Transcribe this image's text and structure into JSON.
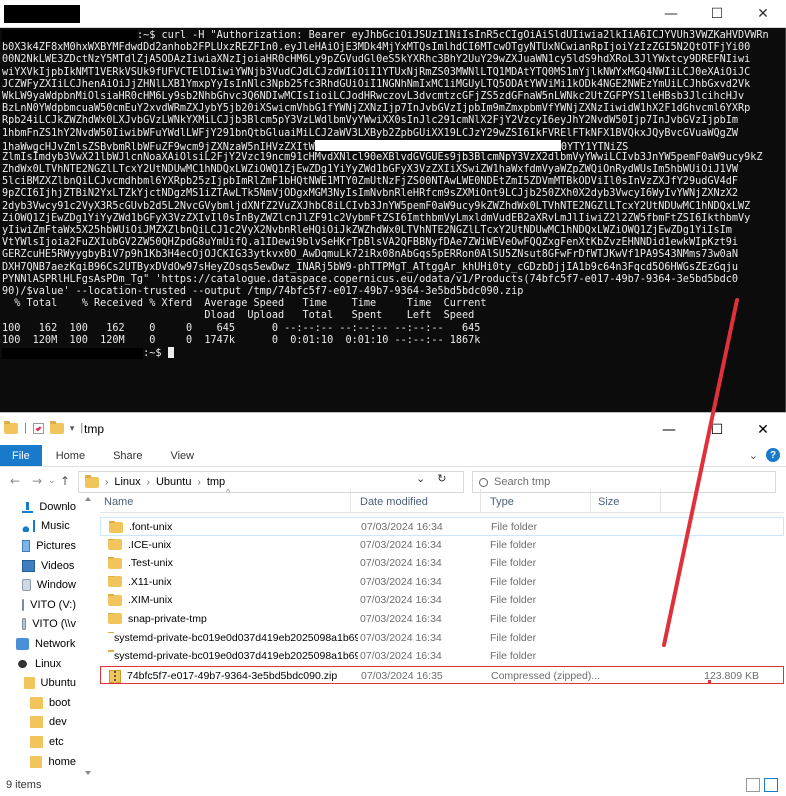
{
  "terminal": {
    "window_controls": [
      "—",
      "☐",
      "✕"
    ],
    "lines": [
      {
        "redact": "                      ",
        "text": ":~$ curl -H \"Authorization: Bearer eyJhbGciOiJSUzI1NiIsInR5cCIgOiAiSldUIiwia2lkIiA6ICJYVUh3VWZKaHVDVWRn"
      },
      {
        "text": "b0X3k4ZF8xM0hxWXBYMFdwdDd2anhob2FPLUxzREZFIn0.eyJleHAiOjE3MDk4MjYxMTQsImlhdCI6MTcwOTgyNTUxNCwianRpIjoiYzIzZGI5N2QtOTFjYi00"
      },
      {
        "text": "00N2NkLWE3ZDctNzY5MTdlZjA5ODAzIiwiaXNzIjoiaHR0cHM6Ly9pZGVudGl0eS5kYXRhc3BhY2UuY29wZXJuaWN1cy5ldS9hdXRoL3JlYWxtcy9DREFNIiwi"
      },
      {
        "text": "wiYXVkIjpbIkNMT1VERkVSUk9fUFVCTElDIiwiYWNjb3VudCJdLCJzdWIiOiI1YTUxNjRmZS03MWNlLTQ1MDAtYTQ0MS1mYjlkNWYxMGQ4NWIiLCJ0eXAiOiJC"
      },
      {
        "text": "JCZWFyZXIiLCJhenAiOiJjZHNlLXB1YmxpYyIsInNlc3Npb25fc3RhdGUiOiI1NGNhNmIxMC1iMGUyLTQ5ODAtYWViMi1kODk4NGE2NWEzYmUiLCJhbGxvd2Vk"
      },
      {
        "text": "WkLW9yaWdpbnMiOlsiaHR0cHM6Ly9sb2NhbGhvc3Q6NDIwMCIsIioiLCJodHRwczovL3dvcmtzcGFjZS5zdGFnaW5nLWNkc2UtZGFPYS1leHBsb3JlcihcHJv"
      },
      {
        "text": "BzLnN0YWdpbmcuaW50cmEuY2xvdWRmZXJybY5jb20iXSwicmVhbG1fYWNjZXNzIjp7InJvbGVzIjpbIm9mZmxpbmVfYWNjZXNzIiwidW1hX2F1dGhvcml6YXRp"
      },
      {
        "text": "Rpb24iLCJkZWZhdWx0LXJvbGVzLWNkYXMiLCJjb3Blcm5pY3VzLWdlbmVyYWwiXX0sInJlc291cmNlX2FjY2VzcyI6eyJhY2NvdW50Ijp7InJvbGVzIjpbIm"
      },
      {
        "text": "1hbmFnZS1hY2NvdW50IiwibWFuYWdlLWFjY291bnQtbGluaiMiLCJ2aWV3LXByb2ZpbGUiXX19LCJzY29wZSI6IkFVRElFTkNFX1BVQkxJQyBvcGVuaWQgZW"
      },
      {
        "text": "1haWwgcHJvZmlsZSBvbmRlbWFuZF9wcm9jZXNzaW5nIHVzZXItW",
        "whitebar": 40,
        "tail": "0YTY1YTNiZS"
      },
      {
        "text": "ZlmIsImdyb3VwX21lbWJlcnNoaXAiOlsiL2FjY2Vzc19ncm91cHMvdXNlcl90eXBlvdGVGUEs9jb3BlcmNpY3VzX2dlbmVyYWwiLCIvb3JnYW5pemF0aW9ucy9kZ"
      },
      {
        "text": "ZhdWx0LTVhNTE2NGZlLTcxY2UtNDUwMC1hNDQxLWZiOWQ1ZjEwZDg1YiYyZWd1bGFyX3VzZXIiXSwiZW1haWxfdmVyaWZpZWQiOnRydWUsIm5hbWUiOiJ1VW"
      },
      {
        "text": "5lciBMZXZlbnQiLCJvcmdhbml6YXRpb25zIjpbImRlZmF1bHQtNWE1MTY0ZmUtNzFjZS00NTAwLWE0NDEtZmI5ZDVmMTBkODViIl0sInVzZXJfY29udGV4dF"
      },
      {
        "text": "9pZCI6IjhjZTBiN2YxLTZkYjctNDgzMS1iZTAwLTk5NmVjODgxMGM3NyIsImNvbnRleHRfcm9sZXMiOnt9LCJjb250ZXh0X2dyb3VwcyI6WyIvYWNjZXNzX2"
      },
      {
        "text": "2dyb3Vwcy91c2VyX3R5cGUvb2d5L2NvcGVybmljdXNfZ2VuZXJhbC8iLCIvb3JnYW5pemF0aW9ucy9kZWZhdWx0LTVhNTE2NGZlLTcxY2UtNDUwMC1hNDQxLWZ"
      },
      {
        "text": "ZiOWQ1ZjEwZDg1YiYyZWd1bGFyX3VzZXIvIl0sInByZWZlcnJlZF91c2VybmFtZSI6ImthbmVyLmxldmVudEB2aXRvLmJlIiwiZ2l2ZW5fbmFtZSI6IkthbmVy"
      },
      {
        "text": "yIiwiZmFtaWx5X25hbWUiOiJMZXZlbnQiLCJ1c2VyX2NvbnRleHQiOiJkZWZhdWx0LTVhNTE2NGZlLTcxY2UtNDUwMC1hNDQxLWZiOWQ1ZjEwZDg1YiIsIm"
      },
      {
        "text": "VtYWlsIjoia2FuZXIubGV2ZW50QHZpdG8uYmUifQ.a1IDewi9blvSeHKrTpBlsVA2QFBBNyfDAe7ZWiWEVeOwFQQZxgFenXtKbZvzEHNNDid1ewkWIpKzt9i"
      },
      {
        "text": "GERZcuHE5RWyygbyBiV7p9h1Kb3H4ecOjOJCKIG33ytkvx0O_AwDqmuLk72iRx08nAbGqs5pERRon0AlSU5ZNsut8GFwFrDfWTJKwVf1PA9S43NMms73w0aN"
      },
      {
        "text": "DXH7QNB7aezKqiB96Cs2UTByxDVdOw97sHeyZOsqs5ewDwz_INARj5bW9-phTTPMgT_ATtggAr_khUHi0ty_cGDzbDjjIA1b9c64n3Fqcd5O6HWGsZEzGqju"
      },
      {
        "text": "PYNNlASPRlHLFgsAsPDm_Tg\" 'https://catalogue.dataspace.copernicus.eu/odata/v1/Products(74bfc5f7-e017-49b7-9364-3e5bd5bdc0"
      },
      {
        "text": "90)/$value' --location-trusted --output /tmp/74bfc5f7-e017-49b7-9364-3e5bd5bdc090.zip"
      },
      {
        "text": "  % Total    % Received % Xferd  Average Speed   Time    Time     Time  Current"
      },
      {
        "text": "                                 Dload  Upload   Total   Spent    Left  Speed"
      },
      {
        "text": "100   162  100   162    0     0    645      0 --:--:-- --:--:-- --:--:--   645"
      },
      {
        "text": "100  120M  100  120M    0     0  1747k      0  0:01:10  0:01:10 --:--:-- 1867k"
      },
      {
        "redact": "                       ",
        "text": ":~$ ",
        "cursor": true
      }
    ]
  },
  "explorer": {
    "title": "tmp",
    "window_controls": [
      "—",
      "☐",
      "✕"
    ],
    "ribbon_tabs": [
      "File",
      "Home",
      "Share",
      "View"
    ],
    "nav": {
      "back": "←",
      "forward": "→",
      "up": "↑",
      "recent": "⌄"
    },
    "address": [
      "Linux",
      "Ubuntu",
      "tmp"
    ],
    "address_dropdown": "⌄",
    "refresh": "↻",
    "search_placeholder": "Search tmp",
    "columns": {
      "name": "Name",
      "date": "Date modified",
      "type": "Type",
      "size": "Size"
    },
    "files": [
      {
        "name": ".font-unix",
        "date": "07/03/2024 16:34",
        "type": "File folder",
        "size": ""
      },
      {
        "name": ".ICE-unix",
        "date": "07/03/2024 16:34",
        "type": "File folder",
        "size": ""
      },
      {
        "name": ".Test-unix",
        "date": "07/03/2024 16:34",
        "type": "File folder",
        "size": ""
      },
      {
        "name": ".X11-unix",
        "date": "07/03/2024 16:34",
        "type": "File folder",
        "size": ""
      },
      {
        "name": ".XIM-unix",
        "date": "07/03/2024 16:34",
        "type": "File folder",
        "size": ""
      },
      {
        "name": "snap-private-tmp",
        "date": "07/03/2024 16:34",
        "type": "File folder",
        "size": ""
      },
      {
        "name": "systemd-private-bc019e0d037d419eb2025098a1b692...",
        "date": "07/03/2024 16:34",
        "type": "File folder",
        "size": ""
      },
      {
        "name": "systemd-private-bc019e0d037d419eb2025098a1b692...",
        "date": "07/03/2024 16:34",
        "type": "File folder",
        "size": ""
      },
      {
        "name": "74bfc5f7-e017-49b7-9364-3e5bd5bdc090.zip",
        "date": "07/03/2024 16:35",
        "type": "Compressed (zipped)...",
        "size": "123.809 KB"
      }
    ],
    "nav_pane": [
      {
        "label": "Downlo",
        "icon": "download-icon",
        "indent": 22
      },
      {
        "label": "Music",
        "icon": "music-icon",
        "indent": 22
      },
      {
        "label": "Pictures",
        "icon": "pictures-icon",
        "indent": 22
      },
      {
        "label": "Videos",
        "icon": "videos-icon",
        "indent": 22
      },
      {
        "label": "Window",
        "icon": "drive-icon",
        "indent": 22
      },
      {
        "label": "VITO (V:)",
        "icon": "network-drive-icon",
        "indent": 22
      },
      {
        "label": "VITO (\\\\v",
        "icon": "network-drive-icon",
        "indent": 22
      },
      {
        "label": "Network",
        "icon": "network-icon",
        "indent": 16
      },
      {
        "label": "Linux",
        "icon": "linux-icon",
        "indent": 16
      },
      {
        "label": "Ubuntu",
        "icon": "folder-icon",
        "indent": 24
      },
      {
        "label": "boot",
        "icon": "folder-icon",
        "indent": 30
      },
      {
        "label": "dev",
        "icon": "folder-icon",
        "indent": 30
      },
      {
        "label": "etc",
        "icon": "folder-icon",
        "indent": 30
      },
      {
        "label": "home",
        "icon": "folder-icon",
        "indent": 30
      }
    ],
    "status": "9 items",
    "colors": {
      "accent": "#1979ca",
      "annotation": "#e0303a",
      "folder": "#f2c55c"
    }
  }
}
